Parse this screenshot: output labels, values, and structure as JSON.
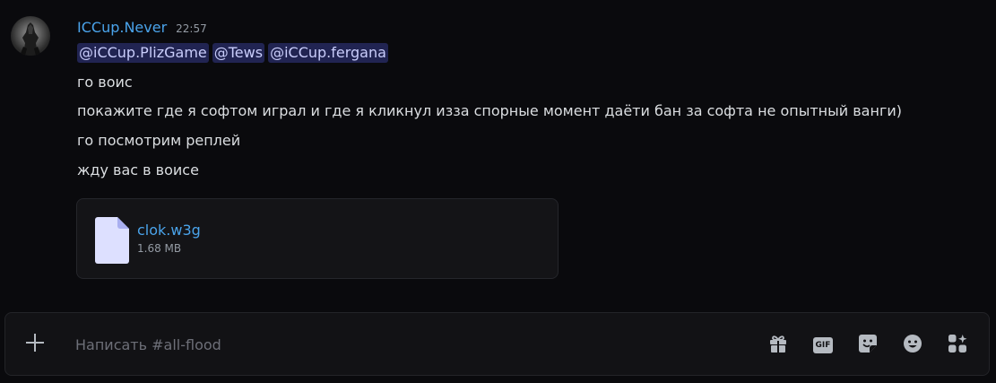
{
  "message": {
    "username": "ICCup.Never",
    "timestamp": "22:57",
    "mentions": [
      "@iCCup.PlizGame",
      "@Tews",
      "@iCCup.fergana"
    ],
    "lines": [
      "го воис",
      "покажите где я софтом играл и где я кликнул изза спорные момент даёти бан за софта не опытный ванги)",
      "го посмотрим реплей",
      "жду вас в воисе"
    ],
    "attachment": {
      "file_name": "clok.w3g",
      "file_size": "1.68 MB",
      "icon": "file-icon"
    }
  },
  "composer": {
    "placeholder": "Написать #all-flood",
    "add_icon": "plus-icon",
    "tools": [
      "gift-icon",
      "gif-icon",
      "sticker-icon",
      "emoji-icon",
      "apps-icon"
    ],
    "gif_label": "GIF"
  },
  "colors": {
    "background": "#0a0a0d",
    "username": "#4aa3ea",
    "link": "#4aa3ea",
    "mention_bg": "rgba(88,101,242,0.3)",
    "mention_text": "#c9cdfb"
  }
}
